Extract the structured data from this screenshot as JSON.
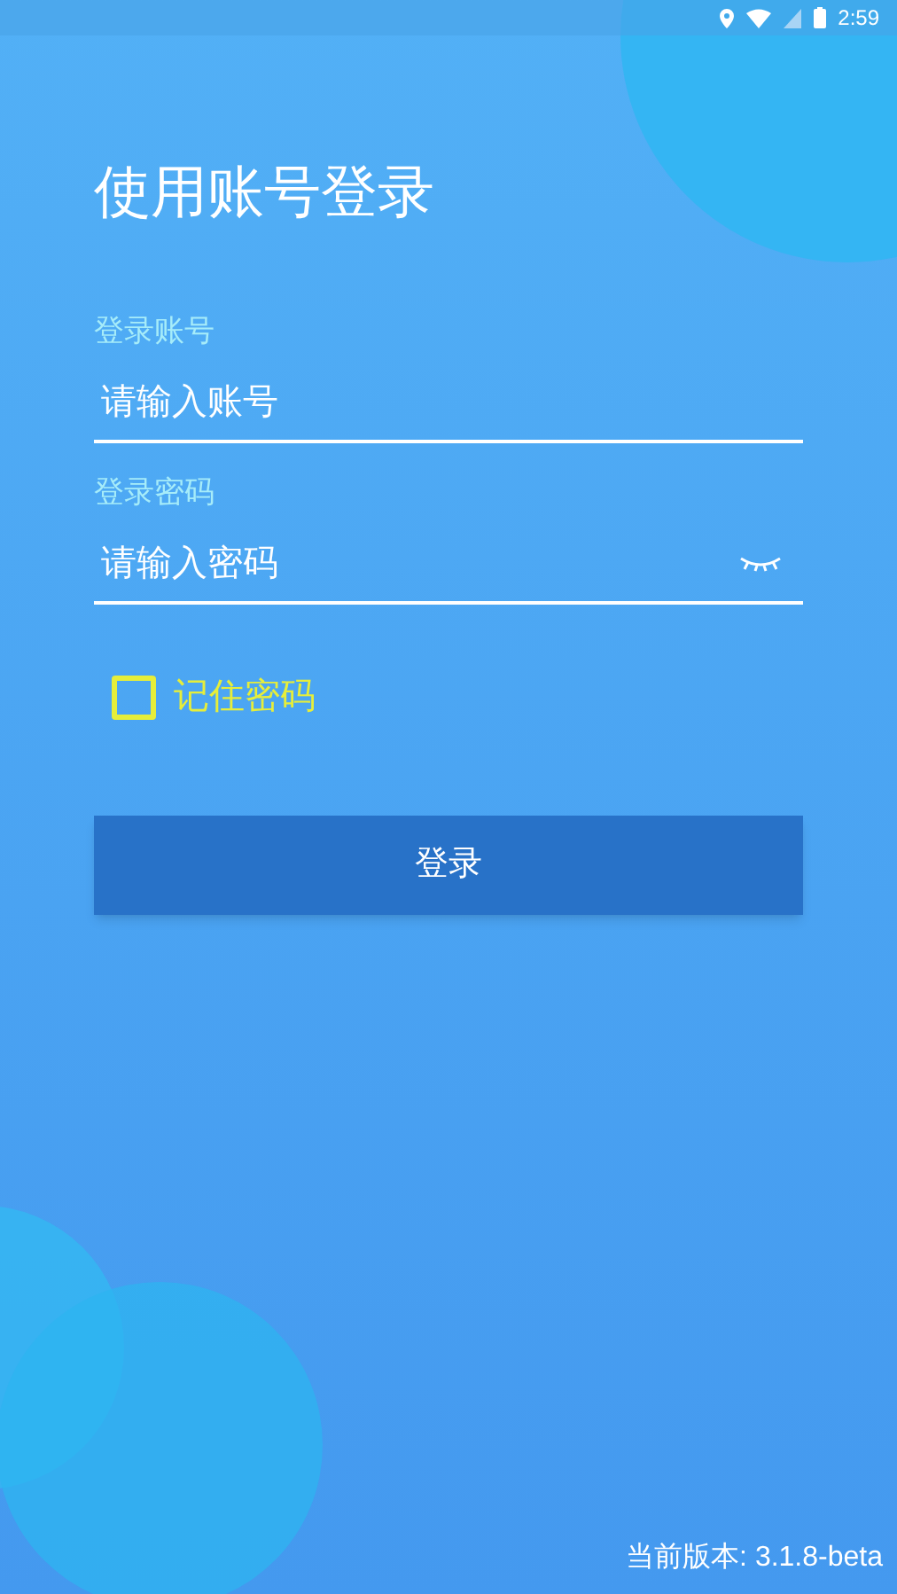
{
  "status_bar": {
    "time": "2:59"
  },
  "title": "使用账号登录",
  "fields": [
    {
      "label": "登录账号",
      "placeholder": "请输入账号",
      "kind": "text"
    },
    {
      "label": "登录密码",
      "placeholder": "请输入密码",
      "kind": "password"
    }
  ],
  "remember": {
    "label": "记住密码",
    "checked": false
  },
  "login_button": "登录",
  "version": "当前版本: 3.1.8-beta"
}
